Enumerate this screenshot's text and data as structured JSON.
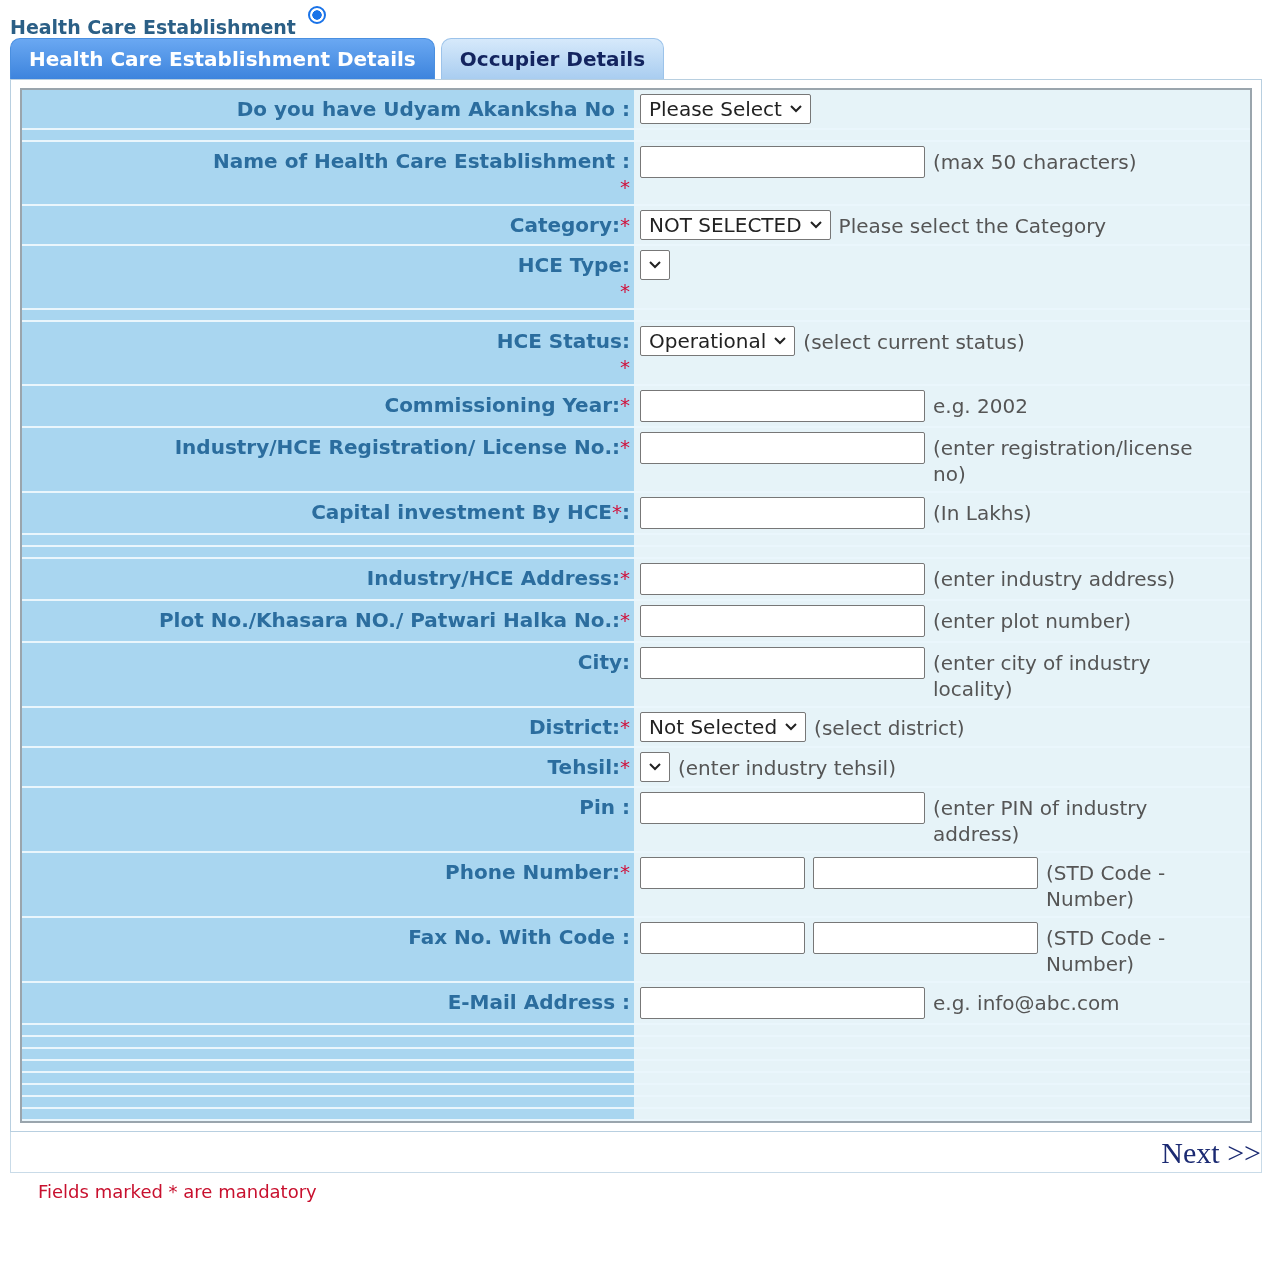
{
  "heading": {
    "title": "Health Care Establishment",
    "radio_selected": true
  },
  "tabs": [
    {
      "label": "Health Care Establishment Details",
      "selected": true
    },
    {
      "label": "Occupier Details",
      "selected": false
    }
  ],
  "rows": [
    {
      "kind": "select",
      "label": "Do you have Udyam Akanksha No :",
      "value": "Please Select"
    },
    {
      "kind": "spacer"
    },
    {
      "kind": "text",
      "label": "Name of Health Care Establishment :",
      "star": "*",
      "star_below": true,
      "hint": "(max 50 characters)"
    },
    {
      "kind": "select",
      "label": "Category:",
      "star": "*",
      "star_below": false,
      "value": "NOT SELECTED",
      "hint": "Please select the Category"
    },
    {
      "kind": "select",
      "label": "HCE Type:",
      "star": "*",
      "star_below": true,
      "value": ""
    },
    {
      "kind": "spacer"
    },
    {
      "kind": "select",
      "label": "HCE Status:",
      "star": "*",
      "star_below": true,
      "value": "Operational",
      "hint": "(select current status)"
    },
    {
      "kind": "text",
      "label": "Commissioning Year:",
      "star": "*",
      "star_below": false,
      "hint": "e.g. 2002"
    },
    {
      "kind": "text",
      "label": "Industry/HCE Registration/ License No.:",
      "star": "*",
      "star_below": false,
      "hint": "(enter registration/license no)"
    },
    {
      "kind": "text",
      "label": "Capital investment By HCE",
      "star": "*",
      "star_below": false,
      "after": ":",
      "hint": "(In Lakhs)"
    },
    {
      "kind": "spacer"
    },
    {
      "kind": "spacer"
    },
    {
      "kind": "text",
      "label": "Industry/HCE Address:",
      "star": "*",
      "star_below": false,
      "hint": "(enter industry address)"
    },
    {
      "kind": "text",
      "label": "Plot No./Khasara NO./ Patwari Halka No.:",
      "star": "*",
      "star_below": false,
      "hint": "(enter plot number)"
    },
    {
      "kind": "text",
      "label": "City:",
      "hint": "(enter city of industry locality)"
    },
    {
      "kind": "select",
      "label": "District:",
      "star": "*",
      "star_below": false,
      "value": "Not Selected",
      "hint": "(select district)"
    },
    {
      "kind": "select",
      "label": "Tehsil:",
      "star": "*",
      "star_below": false,
      "value": "",
      "hint": "(enter industry tehsil)"
    },
    {
      "kind": "text",
      "label": "Pin :",
      "hint": "(enter PIN of industry address)"
    },
    {
      "kind": "phone",
      "label": "Phone Number:",
      "star": "*",
      "star_below": false,
      "hint": "(STD Code - Number)"
    },
    {
      "kind": "phone",
      "label": "Fax No. With Code :",
      "hint": "(STD Code - Number)"
    },
    {
      "kind": "text",
      "label": "E-Mail Address :",
      "hint": "e.g. info@abc.com"
    },
    {
      "kind": "spacer"
    },
    {
      "kind": "spacer"
    },
    {
      "kind": "spacer"
    },
    {
      "kind": "spacer"
    },
    {
      "kind": "spacer"
    },
    {
      "kind": "spacer"
    },
    {
      "kind": "spacer"
    },
    {
      "kind": "spacer"
    }
  ],
  "next_link": "Next >>",
  "footer_note": "Fields marked * are mandatory"
}
